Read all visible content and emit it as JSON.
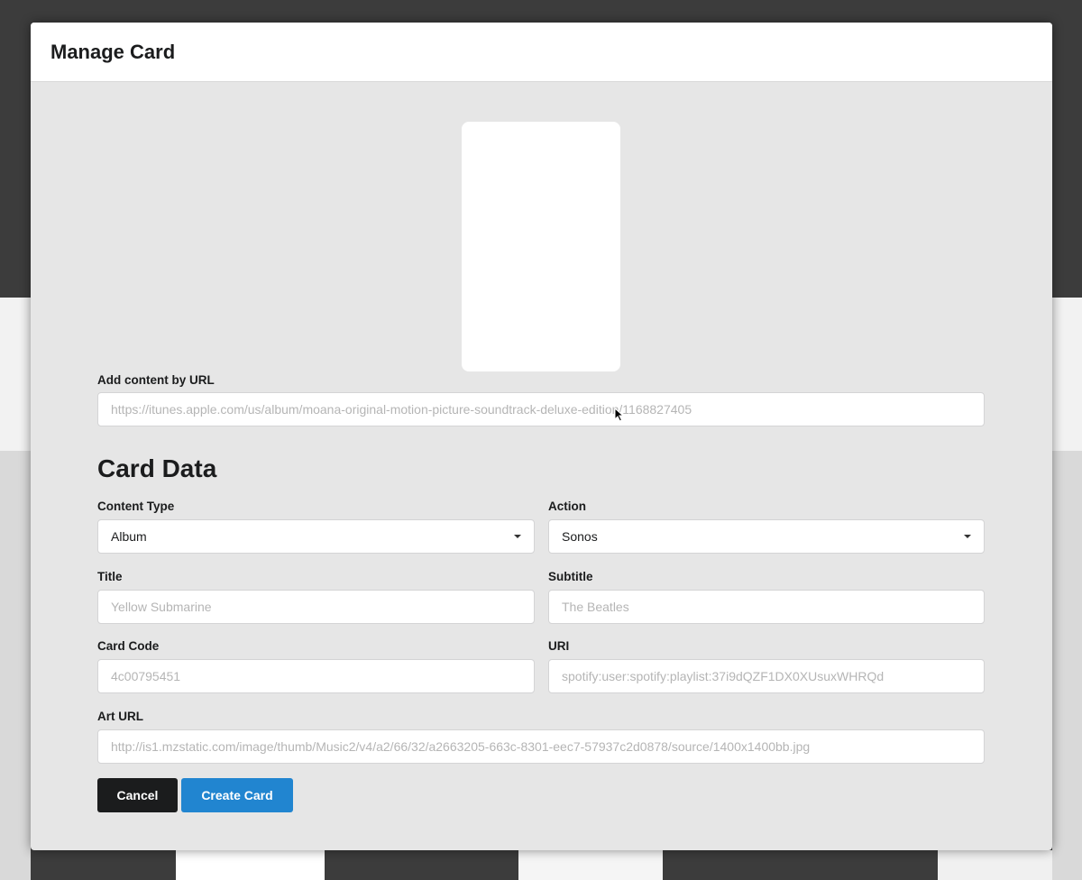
{
  "modal": {
    "title": "Manage Card"
  },
  "add_by_url": {
    "label": "Add content by URL",
    "placeholder": "https://itunes.apple.com/us/album/moana-original-motion-picture-soundtrack-deluxe-edition/1168827405",
    "value": ""
  },
  "card_data": {
    "heading": "Card Data",
    "content_type": {
      "label": "Content Type",
      "selected": "Album"
    },
    "action": {
      "label": "Action",
      "selected": "Sonos"
    },
    "title": {
      "label": "Title",
      "placeholder": "Yellow Submarine",
      "value": ""
    },
    "subtitle": {
      "label": "Subtitle",
      "placeholder": "The Beatles",
      "value": ""
    },
    "card_code": {
      "label": "Card Code",
      "placeholder": "4c00795451",
      "value": ""
    },
    "uri": {
      "label": "URI",
      "placeholder": "spotify:user:spotify:playlist:37i9dQZF1DX0XUsuxWHRQd",
      "value": ""
    },
    "art_url": {
      "label": "Art URL",
      "placeholder": "http://is1.mzstatic.com/image/thumb/Music2/v4/a2/66/32/a2663205-663c-8301-eec7-57937c2d0878/source/1400x1400bb.jpg",
      "value": ""
    }
  },
  "buttons": {
    "cancel": "Cancel",
    "create": "Create Card"
  },
  "colors": {
    "primary": "#2185d0",
    "dark": "#1b1c1d",
    "modal_body": "#e6e6e6",
    "backdrop": "#3c3c3c"
  },
  "icons": {
    "dropdown": "chevron-down-icon",
    "cursor": "mouse-pointer-icon"
  }
}
